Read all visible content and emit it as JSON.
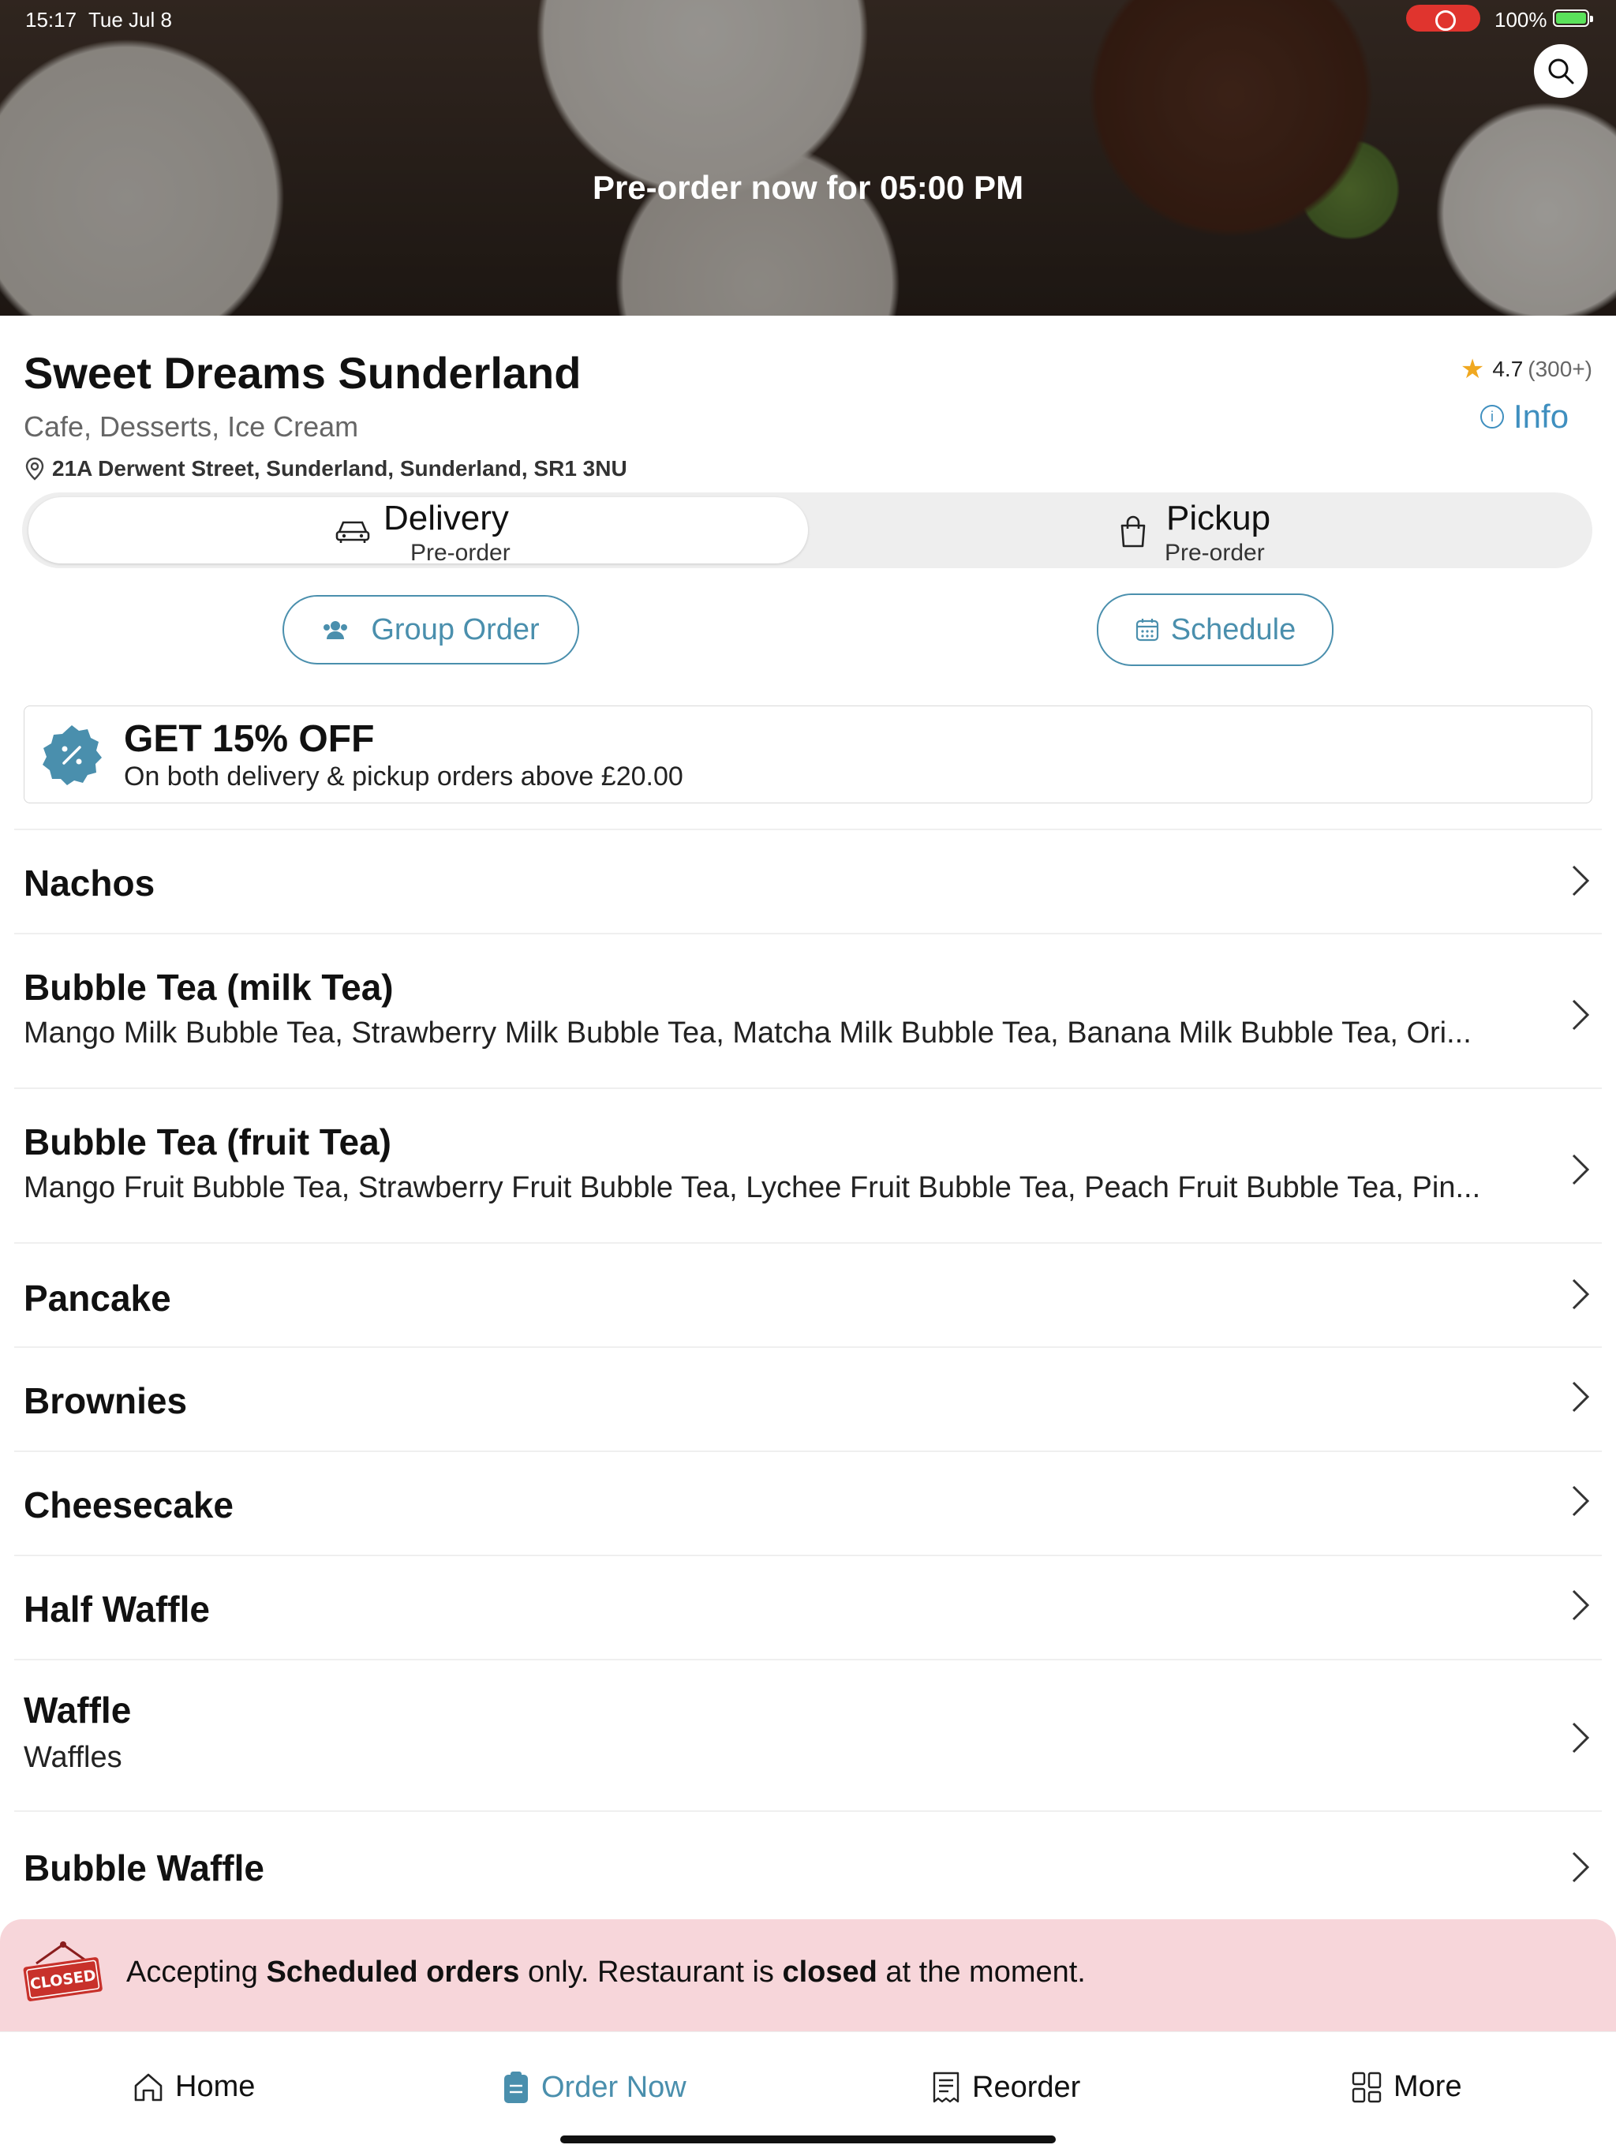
{
  "status_bar": {
    "time": "15:17",
    "date": "Tue Jul 8",
    "battery": "100%"
  },
  "hero": {
    "title": "Pre-order now for 05:00 PM"
  },
  "restaurant": {
    "name": "Sweet Dreams Sunderland",
    "categories": "Cafe, Desserts, Ice Cream",
    "address": "21A Derwent Street, Sunderland, Sunderland, SR1 3NU",
    "rating": "4.7",
    "rating_count": "(300+)",
    "info_label": "Info"
  },
  "order_mode": {
    "delivery": {
      "label": "Delivery",
      "sub": "Pre-order",
      "selected": true
    },
    "pickup": {
      "label": "Pickup",
      "sub": "Pre-order",
      "selected": false
    }
  },
  "actions": {
    "group_order": "Group Order",
    "schedule": "Schedule"
  },
  "promo": {
    "title": "GET 15% OFF",
    "subtitle": "On both delivery & pickup orders above £20.00",
    "badge_color": "#4a8fad"
  },
  "menu": {
    "categories": [
      {
        "title": "Nachos",
        "desc": ""
      },
      {
        "title": "Bubble Tea (milk Tea)",
        "desc": "Mango Milk Bubble Tea, Strawberry Milk Bubble Tea, Matcha Milk Bubble Tea, Banana Milk Bubble Tea, Ori..."
      },
      {
        "title": "Bubble Tea (fruit Tea)",
        "desc": "Mango Fruit Bubble Tea, Strawberry Fruit Bubble Tea, Lychee Fruit Bubble Tea, Peach Fruit Bubble Tea, Pin..."
      },
      {
        "title": "Pancake",
        "desc": ""
      },
      {
        "title": "Brownies",
        "desc": ""
      },
      {
        "title": "Cheesecake",
        "desc": ""
      },
      {
        "title": "Half Waffle",
        "desc": ""
      },
      {
        "title": "Waffle",
        "desc": "Waffles"
      },
      {
        "title": "Bubble Waffle",
        "desc": ""
      }
    ]
  },
  "closed_banner": {
    "sign": "CLOSED",
    "t1": "Accepting ",
    "b1": "Scheduled orders",
    "t2": " only. Restaurant is ",
    "b2": "closed",
    "t3": " at the moment.",
    "bg_color": "#f7d6da"
  },
  "tabbar": {
    "home": "Home",
    "order_now": "Order Now",
    "reorder": "Reorder",
    "more": "More",
    "active": "order_now",
    "accent": "#4a8fad"
  }
}
